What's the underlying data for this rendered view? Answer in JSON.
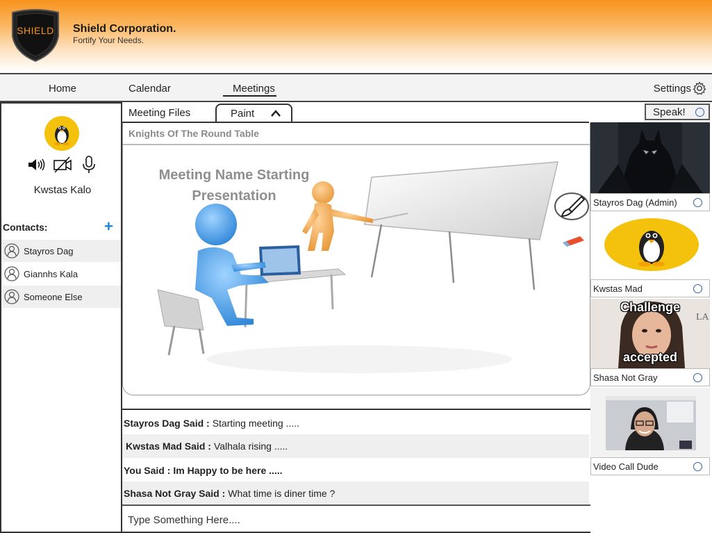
{
  "header": {
    "logo_text": "SHIELD",
    "company_name": "Shield Corporation.",
    "tagline": "Fortify Your Needs."
  },
  "nav": {
    "home": "Home",
    "calendar": "Calendar",
    "meetings": "Meetings",
    "settings": "Settings"
  },
  "sidebar": {
    "user_name": "Kwstas Kalo",
    "contacts_label": "Contacts:",
    "add_icon": "plus-icon",
    "contacts": [
      {
        "name": "Stayros Dag"
      },
      {
        "name": "Giannhs Kala"
      },
      {
        "name": "Someone Else"
      }
    ]
  },
  "tabs": {
    "files": "Meeting Files",
    "paint": "Paint"
  },
  "speak": {
    "label": "Speak!"
  },
  "board": {
    "title": "Knights Of The Round Table",
    "slide_title": "Meeting Name Starting Presentation"
  },
  "chat": {
    "messages": [
      {
        "sender": "Stayros Dag Said :",
        "text": "Starting meeting ....."
      },
      {
        "sender": "Kwstas Mad Said :",
        "text": "Valhala rising ....."
      },
      {
        "sender": "You Said :",
        "text": "Im Happy to be here ....."
      },
      {
        "sender": "Shasa Not Gray Said :",
        "text": "What time is diner time ?"
      }
    ],
    "input_placeholder": "Type Something Here...."
  },
  "participants": [
    {
      "name": "Stayros Dag (Admin)"
    },
    {
      "name": "Kwstas Mad"
    },
    {
      "name": "Shasa Not Gray",
      "overlay_top": "Challenge",
      "overlay_bottom": "accepted"
    },
    {
      "name": "Video Call Dude"
    }
  ],
  "colors": {
    "accent": "#f7931e",
    "avatar_yellow": "#f4c20d",
    "add_blue": "#1a86d6",
    "radio_blue": "#2b5fa8"
  }
}
